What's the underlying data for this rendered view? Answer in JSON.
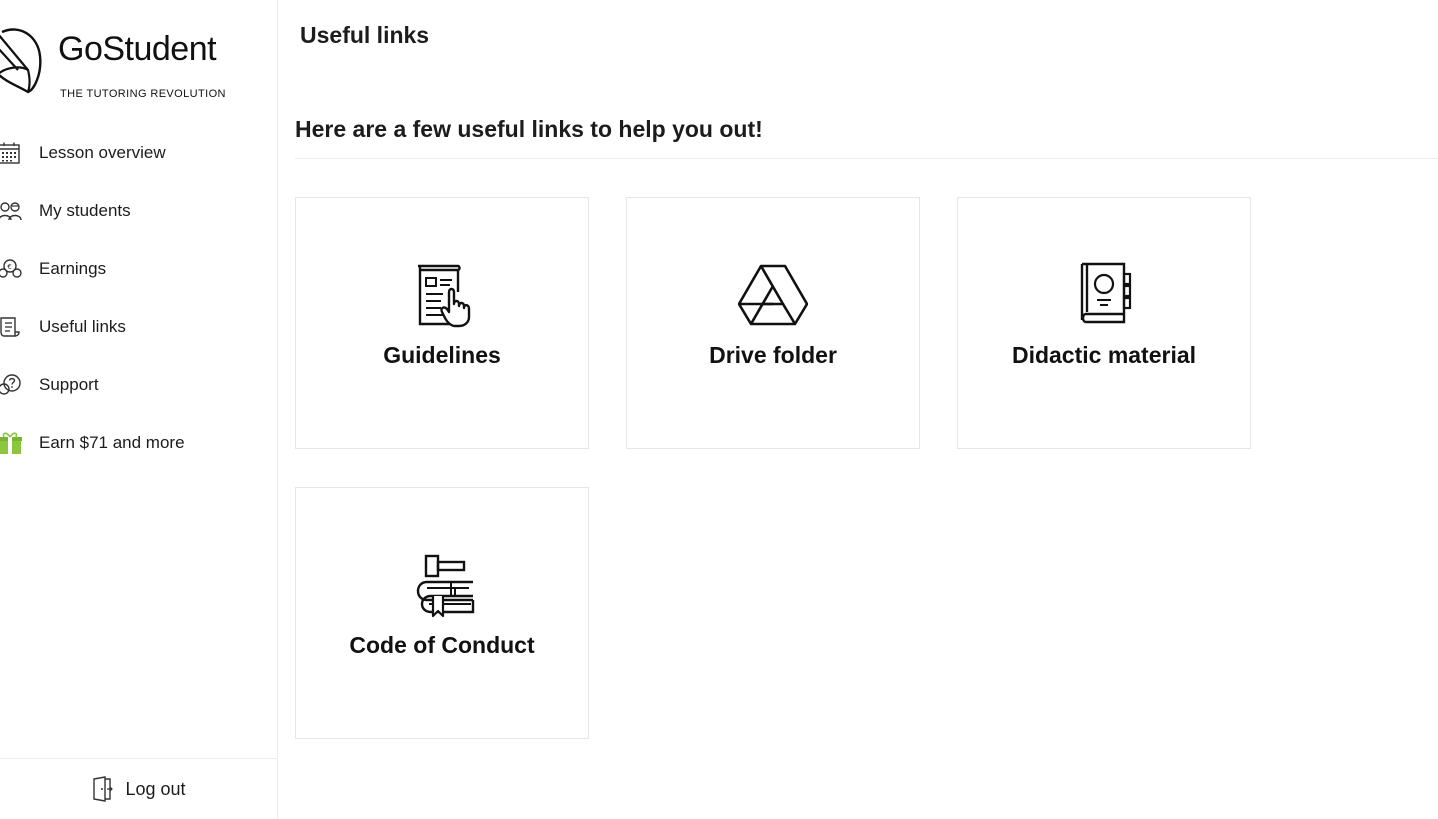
{
  "brand": {
    "name": "GoStudent",
    "tagline": "THE TUTORING REVOLUTION"
  },
  "sidebar": {
    "items": [
      {
        "label": "Lesson overview",
        "icon": "calendar-icon"
      },
      {
        "label": "My students",
        "icon": "students-icon"
      },
      {
        "label": "Earnings",
        "icon": "coins-icon"
      },
      {
        "label": "Useful links",
        "icon": "scroll-icon"
      },
      {
        "label": "Support",
        "icon": "question-bubble-icon"
      },
      {
        "label": "Earn $71 and more",
        "icon": "gift-icon"
      }
    ],
    "logout_label": "Log out"
  },
  "main": {
    "title": "Useful links",
    "heading": "Here are a few useful links to help you out!",
    "cards": [
      {
        "label": "Guidelines",
        "icon": "document-pointer-icon"
      },
      {
        "label": "Drive folder",
        "icon": "drive-icon"
      },
      {
        "label": "Didactic material",
        "icon": "book-icon"
      },
      {
        "label": "Code of Conduct",
        "icon": "gavel-book-icon"
      }
    ]
  },
  "colors": {
    "text": "#1c1c1c",
    "border": "#e6e6e6",
    "gift_accent": "#8cc63f"
  }
}
